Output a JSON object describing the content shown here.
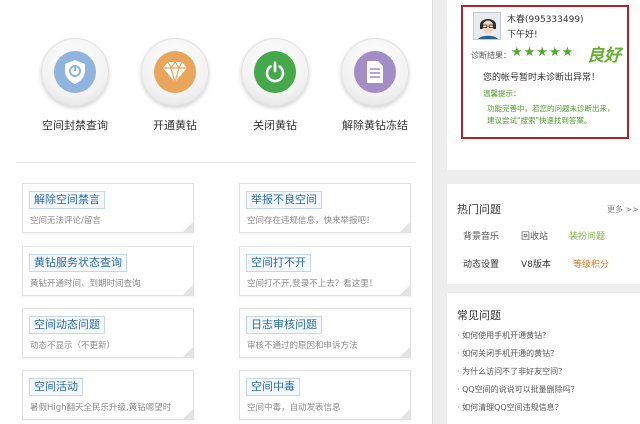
{
  "features": [
    {
      "label": "空间封禁查询",
      "icon": "shield-icon",
      "color": "#8fb4dd"
    },
    {
      "label": "开通黄钻",
      "icon": "diamond-icon",
      "color": "#e9a55a"
    },
    {
      "label": "关闭黄钻",
      "icon": "power-icon",
      "color": "#45a84a"
    },
    {
      "label": "解除黄钻冻结",
      "icon": "document-icon",
      "color": "#a38dc7"
    }
  ],
  "cards": [
    {
      "title": "解除空间禁言",
      "desc": "空间无法评论/留言"
    },
    {
      "title": "举报不良空间",
      "desc": "空间存在违规信息，快来举报吧！"
    },
    {
      "title": "黄钻服务状态查询",
      "desc": "黄钻开通时间、到期时间查询"
    },
    {
      "title": "空间打不开",
      "desc": "空间打不开,登录不上去？看这里！"
    },
    {
      "title": "空间动态问题",
      "desc": "动态不显示（不更新）"
    },
    {
      "title": "日志审核问题",
      "desc": "审核不通过的原因和申诉方法"
    },
    {
      "title": "空间活动",
      "desc": "暑假High翻天全民乐升级,黄钻嗯望时"
    },
    {
      "title": "空间中毒",
      "desc": "空间中毒，自动发表信息"
    }
  ],
  "diagnosis": {
    "username": "木春(995333499)",
    "greeting": "下午好!",
    "label": "诊断结果：",
    "stars": "★★★★★",
    "grade": "良好",
    "result": "您的帐号暂时未诊断出异常！",
    "tip_label": "温馨提示：",
    "tip_lines": [
      "功能完善中，若您的问题未诊断出来，",
      "建议尝试\"搜索\"快速找到答案。"
    ]
  },
  "hot": {
    "title": "热门问题",
    "more": "更多 >>",
    "links": [
      {
        "text": "背景音乐",
        "color": "#555555"
      },
      {
        "text": "回收站",
        "color": "#555555"
      },
      {
        "text": "装扮问题",
        "color": "#7ab245"
      },
      {
        "text": "动态设置",
        "color": "#333333"
      },
      {
        "text": "V8版本",
        "color": "#333333"
      },
      {
        "text": "等级积分",
        "color": "#e0781e"
      }
    ]
  },
  "faq": {
    "title": "常见问题",
    "items": [
      "如何使用手机开通黄钻？",
      "如何关闭手机开通的黄钻？",
      "为什么访问不了非好友空间？",
      "QQ空间的说说可以批量删除吗？",
      "如何清理QQ空间违规信息？"
    ]
  }
}
